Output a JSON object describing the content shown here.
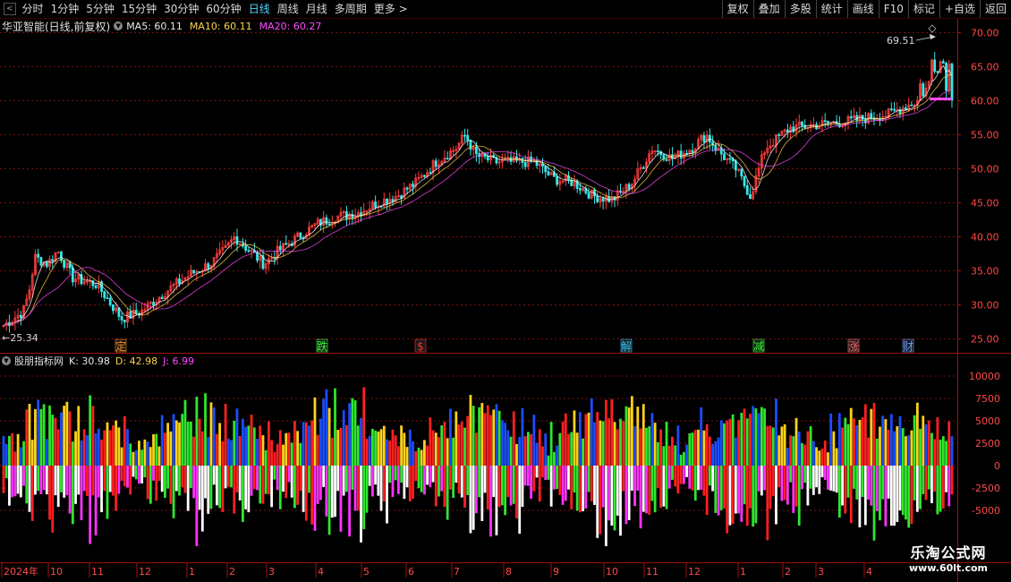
{
  "toolbar": {
    "left": [
      {
        "label": "分时",
        "active": false
      },
      {
        "label": "1分钟",
        "active": false
      },
      {
        "label": "5分钟",
        "active": false
      },
      {
        "label": "15分钟",
        "active": false
      },
      {
        "label": "30分钟",
        "active": false
      },
      {
        "label": "60分钟",
        "active": false
      },
      {
        "label": "日线",
        "active": true
      },
      {
        "label": "周线",
        "active": false
      },
      {
        "label": "月线",
        "active": false
      },
      {
        "label": "多周期",
        "active": false
      },
      {
        "label": "更多 >",
        "active": false
      }
    ],
    "right": [
      "复权",
      "叠加",
      "多股",
      "统计",
      "画线",
      "F10",
      "标记",
      "+自选",
      "返回"
    ]
  },
  "stock": {
    "name": "华亚智能(日线,前复权)",
    "ma5": "MA5: 60.11",
    "ma10": "MA10: 60.11",
    "ma20": "MA20: 60.27"
  },
  "price_axis": [
    "70.00",
    "65.00",
    "60.00",
    "55.00",
    "50.00",
    "45.00",
    "40.00",
    "35.00",
    "30.00",
    "25.00"
  ],
  "annotations": {
    "high": "69.51",
    "low": "25.34",
    "markers": [
      {
        "text": "定",
        "color": "#ff8c1a"
      },
      {
        "text": "跌",
        "color": "#35ff35"
      },
      {
        "text": "$",
        "color": "#ff3030"
      },
      {
        "text": "解",
        "color": "#35c8ff"
      },
      {
        "text": "减",
        "color": "#35ff35"
      },
      {
        "text": "涨",
        "color": "#ff6a6a"
      },
      {
        "text": "财",
        "color": "#6aa0ff"
      }
    ]
  },
  "indicator": {
    "name": "股朋指标网",
    "k": "K: 30.98",
    "d": "D: 42.98",
    "j": "J: 6.99",
    "axis": [
      "10000",
      "7500",
      "5000",
      "2500",
      "0",
      "-2500",
      "-5000"
    ]
  },
  "date_axis": [
    "2024年",
    "10",
    "11",
    "12",
    "1",
    "2",
    "3",
    "4",
    "5",
    "6",
    "7",
    "8",
    "9",
    "10",
    "11",
    "12",
    "1",
    "2",
    "3",
    "4"
  ],
  "watermark": {
    "line1": "乐淘公式网",
    "line2": "www.60lt.com"
  },
  "colors": {
    "up": "#ff3d3d",
    "down": "#34e8e8",
    "ma5": "#ffffff",
    "ma10": "#ffd24a",
    "ma20": "#ff4cff",
    "grid": "#7a1010"
  }
}
